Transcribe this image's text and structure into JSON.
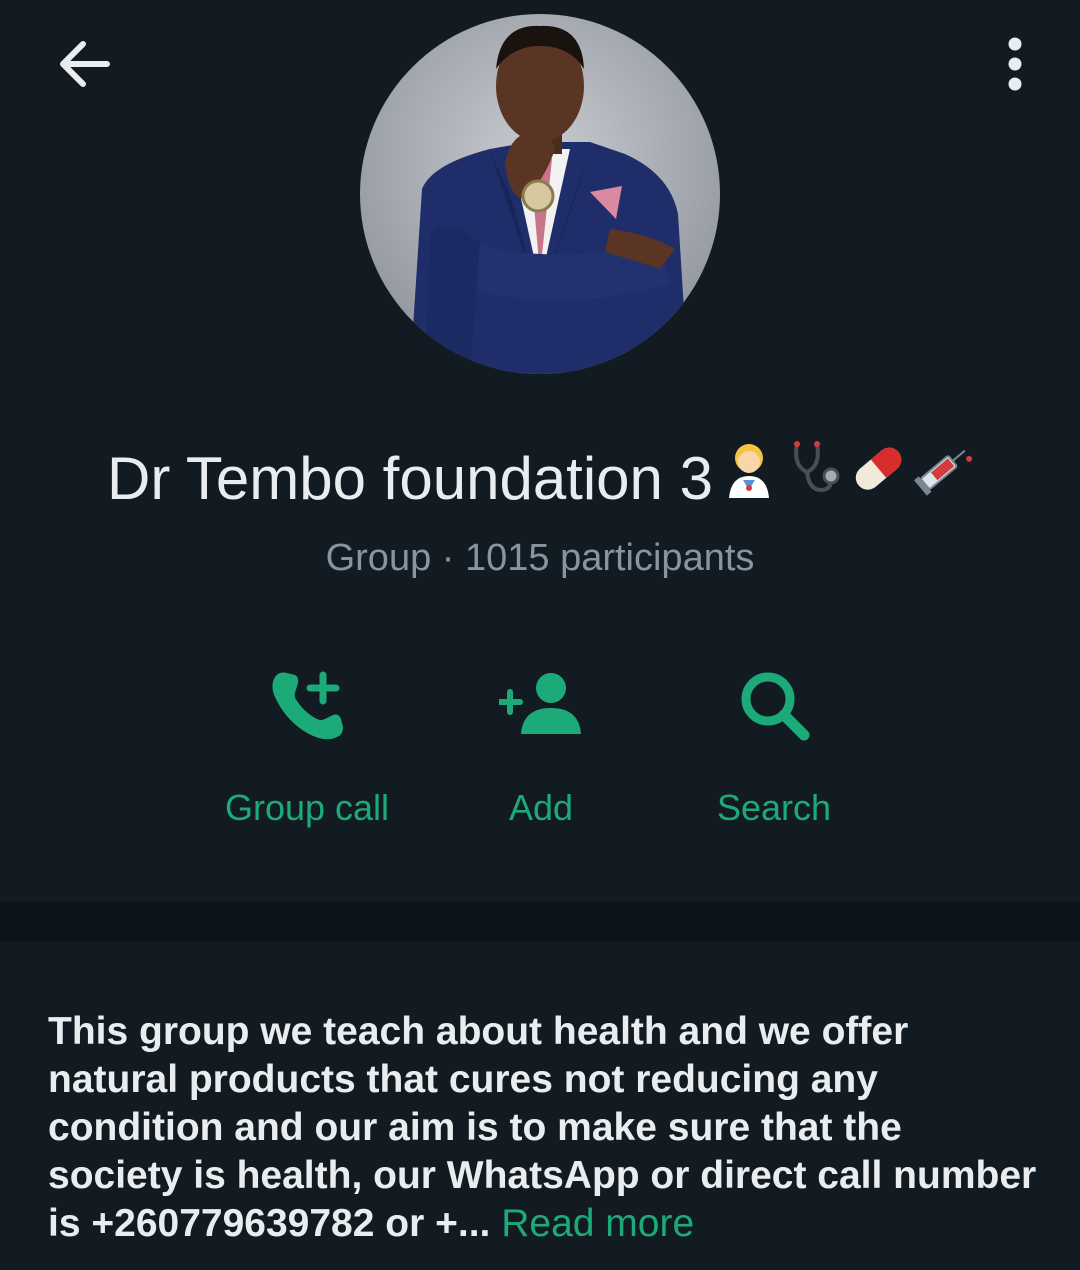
{
  "header": {
    "back_icon": "arrow-left-icon",
    "menu_icon": "more-vertical-icon"
  },
  "profile": {
    "avatar_description": "group-profile-photo",
    "name": "Dr Tembo foundation 3",
    "name_emojis": [
      "health-worker-emoji",
      "stethoscope-emoji",
      "pill-emoji",
      "syringe-emoji"
    ],
    "meta": "Group · 1015 participants"
  },
  "actions": [
    {
      "label": "Group call",
      "icon": "add-call-icon"
    },
    {
      "label": "Add",
      "icon": "add-person-icon"
    },
    {
      "label": "Search",
      "icon": "search-icon"
    }
  ],
  "description": {
    "lines": [
      "This group we teach about health and we offer",
      "natural products that cures not reducing any",
      "condition and our aim is to make sure that the",
      "society is health, our WhatsApp or direct call number",
      "is +260779639782 or +..."
    ],
    "read_more": "Read more"
  },
  "colors": {
    "background": "#111b21",
    "divider": "#0b141a",
    "accent": "#1daa79",
    "primary_text": "#e9edef",
    "secondary_text": "#8696a0"
  }
}
